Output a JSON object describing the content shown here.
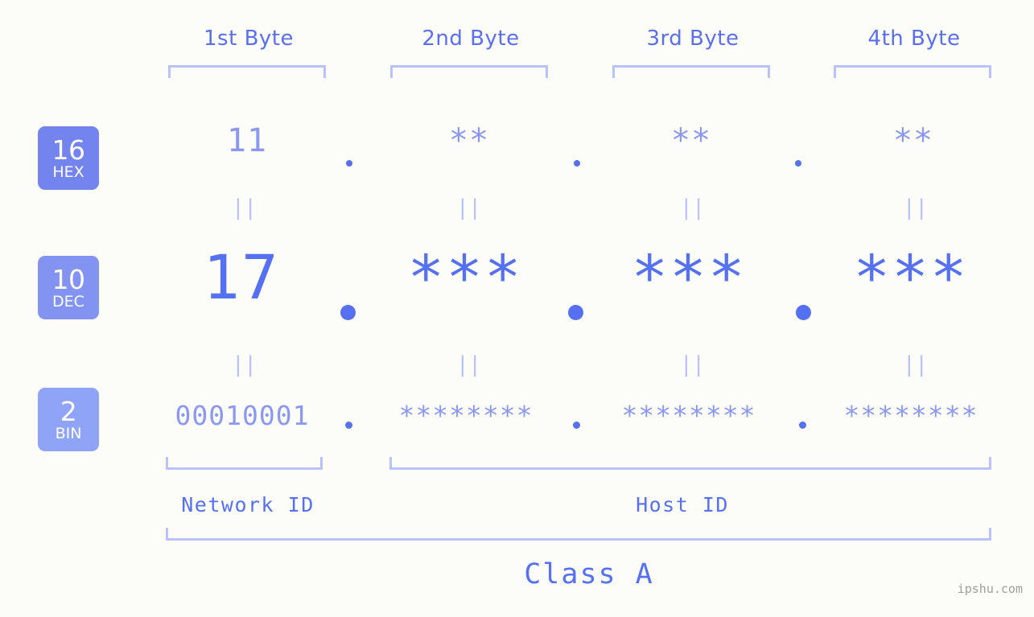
{
  "watermark": "ipshu.com",
  "background_color": "#fcfdf8",
  "accent_color": "#5570f0",
  "accent_light_color": "#8b98ef",
  "bracket_color": "#b9c2fb",
  "headers": [
    {
      "label": "1st Byte"
    },
    {
      "label": "2nd Byte"
    },
    {
      "label": "3rd Byte"
    },
    {
      "label": "4th Byte"
    }
  ],
  "bases": [
    {
      "number": "16",
      "name": "HEX",
      "color": "#7484ee"
    },
    {
      "number": "10",
      "name": "DEC",
      "color": "#8293f2"
    },
    {
      "number": "2",
      "name": "BIN",
      "color": "#8fa4f7"
    }
  ],
  "rows": {
    "hex": {
      "base": "16",
      "name": "HEX",
      "values": [
        "11",
        "**",
        "**",
        "**"
      ]
    },
    "dec": {
      "base": "10",
      "name": "DEC",
      "values": [
        "17",
        "***",
        "***",
        "***"
      ]
    },
    "bin": {
      "base": "2",
      "name": "BIN",
      "values": [
        "00010001",
        "********",
        "********",
        "********"
      ]
    }
  },
  "separators": {
    "dot": ".",
    "equals": "||"
  },
  "footer": {
    "network_id": "Network ID",
    "host_id": "Host ID",
    "class": "Class A"
  }
}
